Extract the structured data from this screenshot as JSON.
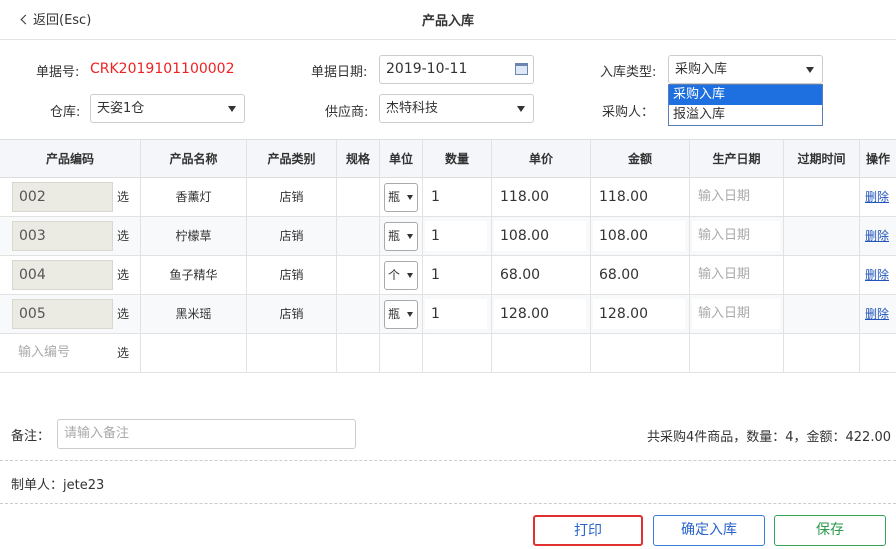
{
  "header": {
    "back_label": "返回(Esc)",
    "title": "产品入库"
  },
  "form": {
    "doc_no_label": "单据号:",
    "doc_no_value": "CRK2019101100002",
    "doc_date_label": "单据日期:",
    "doc_date_value": "2019-10-11",
    "type_label": "入库类型:",
    "type_value": "采购入库",
    "type_options": [
      "采购入库",
      "报溢入库"
    ],
    "warehouse_label": "仓库:",
    "warehouse_value": "天姿1仓",
    "supplier_label": "供应商:",
    "supplier_value": "杰特科技",
    "buyer_label": "采购人："
  },
  "table": {
    "headers": [
      "产品编码",
      "产品名称",
      "产品类别",
      "规格",
      "单位",
      "数量",
      "单价",
      "金额",
      "生产日期",
      "过期时间",
      "操作"
    ],
    "pick_label": "选",
    "date_placeholder": "输入日期",
    "delete_label": "删除",
    "code_placeholder": "输入编号",
    "rows": [
      {
        "code": "002",
        "name": "香薰灯",
        "category": "店销",
        "unit": "瓶",
        "qty": "1",
        "price": "118.00",
        "amount": "118.00"
      },
      {
        "code": "003",
        "name": "柠檬草",
        "category": "店销",
        "unit": "瓶",
        "qty": "1",
        "price": "108.00",
        "amount": "108.00"
      },
      {
        "code": "004",
        "name": "鱼子精华",
        "category": "店销",
        "unit": "个",
        "qty": "1",
        "price": "68.00",
        "amount": "68.00"
      },
      {
        "code": "005",
        "name": "黑米瑶",
        "category": "店销",
        "unit": "瓶",
        "qty": "1",
        "price": "128.00",
        "amount": "128.00"
      }
    ]
  },
  "footer": {
    "remark_label": "备注：",
    "remark_placeholder": "请输入备注",
    "summary": "共采购4件商品，数量：4，金额：422.00",
    "maker": "制单人：jete23",
    "print_label": "打印",
    "confirm_label": "确定入库",
    "save_label": "保存"
  },
  "colors": {
    "doc_no": "#ee2222",
    "highlight": "#1e6fe0",
    "print_border": "#e03030",
    "save": "#2a9a4c"
  }
}
